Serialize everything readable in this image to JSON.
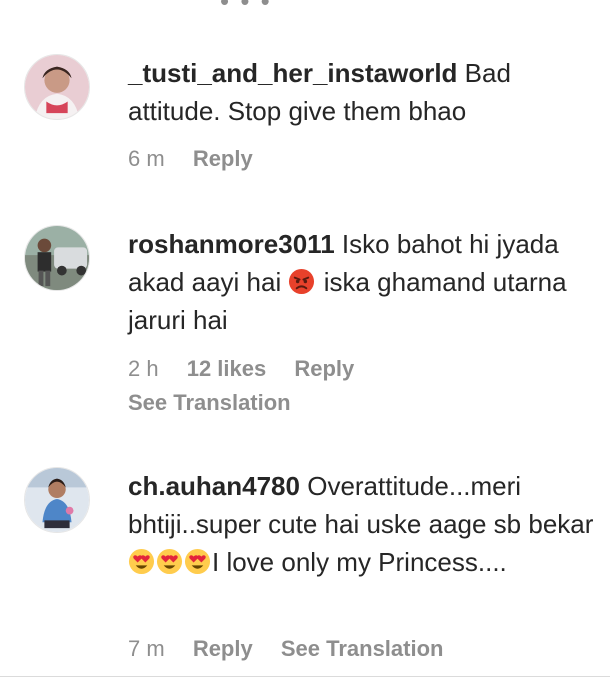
{
  "comments": [
    {
      "username": "_tusti_and_her_instaworld",
      "text": "Bad attitude. Stop give them bhao",
      "time": "6 m",
      "reply_label": "Reply"
    },
    {
      "username": "roshanmore3011",
      "text_before_emoji": "Isko bahot hi jyada akad aayi hai",
      "emoji": "angry-face",
      "text_after_emoji": "iska ghamand utarna jaruri hai",
      "time": "2 h",
      "likes": "12 likes",
      "reply_label": "Reply",
      "see_translation": "See Translation"
    },
    {
      "username": "ch.auhan4780",
      "text_before_emoji": "Overattitude...meri bhtiji..super cute hai uske aage sb bekar",
      "emoji": "heart-eyes x3",
      "text_after_emoji": "I love only my Princess....",
      "time": "7 m",
      "reply_label": "Reply",
      "see_translation": "See Translation"
    }
  ],
  "colors": {
    "text": "#262626",
    "meta": "#8e8e8e",
    "divider": "#dbdbdb"
  }
}
